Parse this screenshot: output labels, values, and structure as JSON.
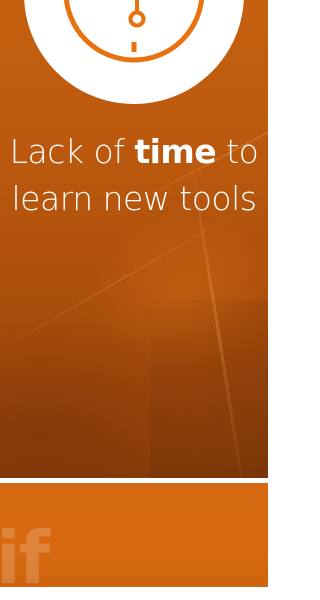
{
  "slide": {
    "headline_part1": "Lack of ",
    "headline_bold": "time",
    "headline_part2": " to learn new tools"
  },
  "watermark_text": "if",
  "icon": "stopwatch-icon",
  "colors": {
    "background_orange": "#b9570d",
    "circle_white": "#ffffff",
    "stopwatch_orange": "#e8720e",
    "bottom_orange": "#d66a12"
  }
}
